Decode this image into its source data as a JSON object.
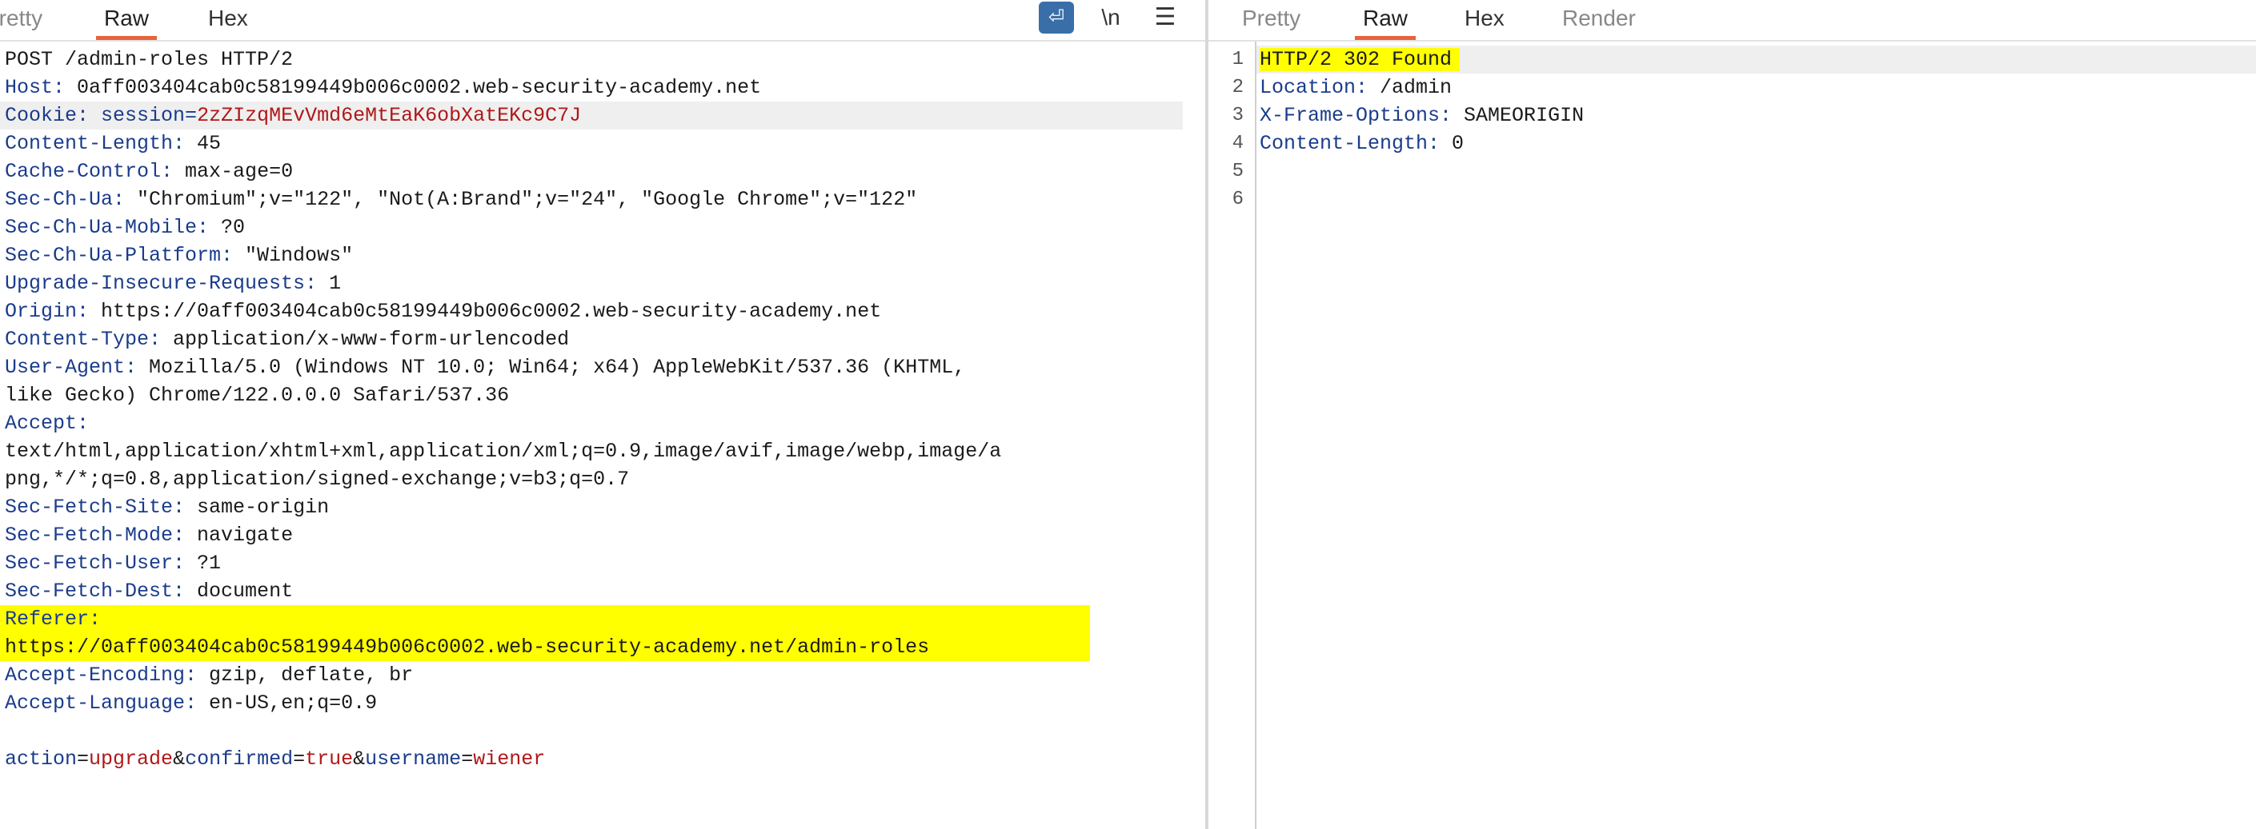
{
  "request": {
    "tabs": [
      "Pretty",
      "Raw",
      "Hex"
    ],
    "active_tab": "Raw",
    "toolbar": {
      "wrap_icon": "⏎",
      "newline_label": "\\n",
      "menu_icon": "☰"
    },
    "lines": {
      "request_line": "POST /admin-roles HTTP/2",
      "host_k": "Host:",
      "host_v": " 0aff003404cab0c58199449b006c0002.web-security-academy.net",
      "cookie_k": "Cookie:",
      "cookie_name": " session=",
      "cookie_val": "2zZIzqMEvVmd6eMtEaK6obXatEKc9C7J",
      "cl_k": "Content-Length:",
      "cl_v": " 45",
      "cc_k": "Cache-Control:",
      "cc_v": " max-age=0",
      "chua_k": "Sec-Ch-Ua:",
      "chua_v": " \"Chromium\";v=\"122\", \"Not(A:Brand\";v=\"24\", \"Google Chrome\";v=\"122\"",
      "chm_k": "Sec-Ch-Ua-Mobile:",
      "chm_v": " ?0",
      "chp_k": "Sec-Ch-Ua-Platform:",
      "chp_v": " \"Windows\"",
      "uir_k": "Upgrade-Insecure-Requests:",
      "uir_v": " 1",
      "origin_k": "Origin:",
      "origin_v": " https://0aff003404cab0c58199449b006c0002.web-security-academy.net",
      "ct_k": "Content-Type:",
      "ct_v": " application/x-www-form-urlencoded",
      "ua_k": "User-Agent:",
      "ua_v": " Mozilla/5.0 (Windows NT 10.0; Win64; x64) AppleWebKit/537.36 (KHTML,",
      "ua_v2": "like Gecko) Chrome/122.0.0.0 Safari/537.36",
      "accept_k": "Accept:",
      "accept_v1": "text/html,application/xhtml+xml,application/xml;q=0.9,image/avif,image/webp,image/a",
      "accept_v2": "png,*/*;q=0.8,application/signed-exchange;v=b3;q=0.7",
      "sfs_k": "Sec-Fetch-Site:",
      "sfs_v": " same-origin",
      "sfm_k": "Sec-Fetch-Mode:",
      "sfm_v": " navigate",
      "sfu_k": "Sec-Fetch-User:",
      "sfu_v": " ?1",
      "sfd_k": "Sec-Fetch-Dest:",
      "sfd_v": " document",
      "ref_k": "Referer:",
      "ref_v": "https://0aff003404cab0c58199449b006c0002.web-security-academy.net/admin-roles",
      "ae_k": "Accept-Encoding:",
      "ae_v": " gzip, deflate, br",
      "al_k": "Accept-Language:",
      "al_v": " en-US,en;q=0.9",
      "body": {
        "p1k": "action",
        "eq": "=",
        "p1v": "upgrade",
        "amp": "&",
        "p2k": "confirmed",
        "p2v": "true",
        "p3k": "username",
        "p3v": "wiener"
      }
    }
  },
  "response": {
    "tabs": [
      "Pretty",
      "Raw",
      "Hex",
      "Render"
    ],
    "active_tab": "Raw",
    "line_numbers": [
      "1",
      "2",
      "3",
      "4",
      "5",
      "6"
    ],
    "status": "HTTP/2 302 Found",
    "loc_k": "Location:",
    "loc_v": " /admin",
    "xfo_k": "X-Frame-Options:",
    "xfo_v": " SAMEORIGIN",
    "cl_k": "Content-Length:",
    "cl_v": " 0"
  },
  "colors": {
    "accent": "#e8623a",
    "highlight": "#ffff00",
    "header_key": "#1a3c8c",
    "value_red": "#b01818"
  }
}
